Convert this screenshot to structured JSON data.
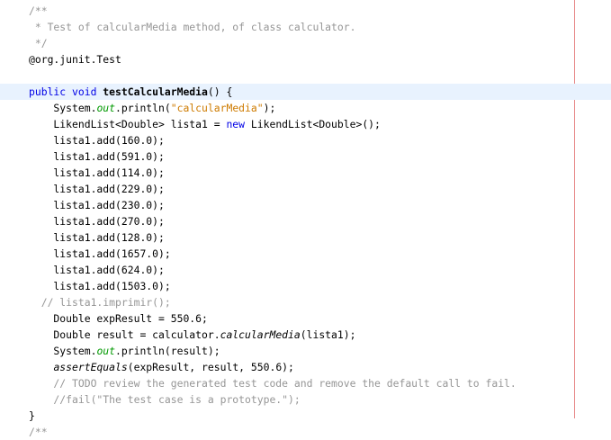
{
  "editor": {
    "current_line_index": 5,
    "colors": {
      "comment": "#969696",
      "keyword": "#0000e6",
      "field": "#009900",
      "string": "#ce7b00",
      "current_line": "#e8f2fe",
      "margin_line": "#e88a8a"
    },
    "lines": [
      [
        {
          "t": "/**",
          "c": "comment"
        }
      ],
      [
        {
          "t": " * Test of calcularMedia method, of class calculator.",
          "c": "comment"
        }
      ],
      [
        {
          "t": " */",
          "c": "comment"
        }
      ],
      [
        {
          "t": "@org.junit.Test",
          "c": "plain"
        }
      ],
      [
        {
          "t": "",
          "c": "plain"
        }
      ],
      [
        {
          "t": "public void ",
          "c": "kw"
        },
        {
          "t": "testCalcularMedia",
          "c": "bold"
        },
        {
          "t": "() {",
          "c": "plain"
        }
      ],
      [
        {
          "t": "    System.",
          "c": "plain"
        },
        {
          "t": "out",
          "c": "field"
        },
        {
          "t": ".println(",
          "c": "plain"
        },
        {
          "t": "\"calcularMedia\"",
          "c": "str"
        },
        {
          "t": ");",
          "c": "plain"
        }
      ],
      [
        {
          "t": "    LikendList<Double> lista1 = ",
          "c": "plain"
        },
        {
          "t": "new",
          "c": "kw"
        },
        {
          "t": " LikendList<Double>();",
          "c": "plain"
        }
      ],
      [
        {
          "t": "    lista1.add(160.0);",
          "c": "plain"
        }
      ],
      [
        {
          "t": "    lista1.add(591.0);",
          "c": "plain"
        }
      ],
      [
        {
          "t": "    lista1.add(114.0);",
          "c": "plain"
        }
      ],
      [
        {
          "t": "    lista1.add(229.0);",
          "c": "plain"
        }
      ],
      [
        {
          "t": "    lista1.add(230.0);",
          "c": "plain"
        }
      ],
      [
        {
          "t": "    lista1.add(270.0);",
          "c": "plain"
        }
      ],
      [
        {
          "t": "    lista1.add(128.0);",
          "c": "plain"
        }
      ],
      [
        {
          "t": "    lista1.add(1657.0);",
          "c": "plain"
        }
      ],
      [
        {
          "t": "    lista1.add(624.0);",
          "c": "plain"
        }
      ],
      [
        {
          "t": "    lista1.add(1503.0);",
          "c": "plain"
        }
      ],
      [
        {
          "t": "  // lista1.imprimir();",
          "c": "comment"
        }
      ],
      [
        {
          "t": "    Double expResult = 550.6;",
          "c": "plain"
        }
      ],
      [
        {
          "t": "    Double result = calculator.",
          "c": "plain"
        },
        {
          "t": "calcularMedia",
          "c": "ital"
        },
        {
          "t": "(lista1);",
          "c": "plain"
        }
      ],
      [
        {
          "t": "    System.",
          "c": "plain"
        },
        {
          "t": "out",
          "c": "field"
        },
        {
          "t": ".println(result);",
          "c": "plain"
        }
      ],
      [
        {
          "t": "    ",
          "c": "plain"
        },
        {
          "t": "assertEquals",
          "c": "ital"
        },
        {
          "t": "(expResult, result, 550.6);",
          "c": "plain"
        }
      ],
      [
        {
          "t": "    // TODO review the generated test code and remove the default call to fail.",
          "c": "comment"
        }
      ],
      [
        {
          "t": "    //fail(\"The test case is a prototype.\");",
          "c": "comment"
        }
      ],
      [
        {
          "t": "}",
          "c": "plain"
        }
      ],
      [
        {
          "t": "/**",
          "c": "comment"
        }
      ]
    ]
  }
}
